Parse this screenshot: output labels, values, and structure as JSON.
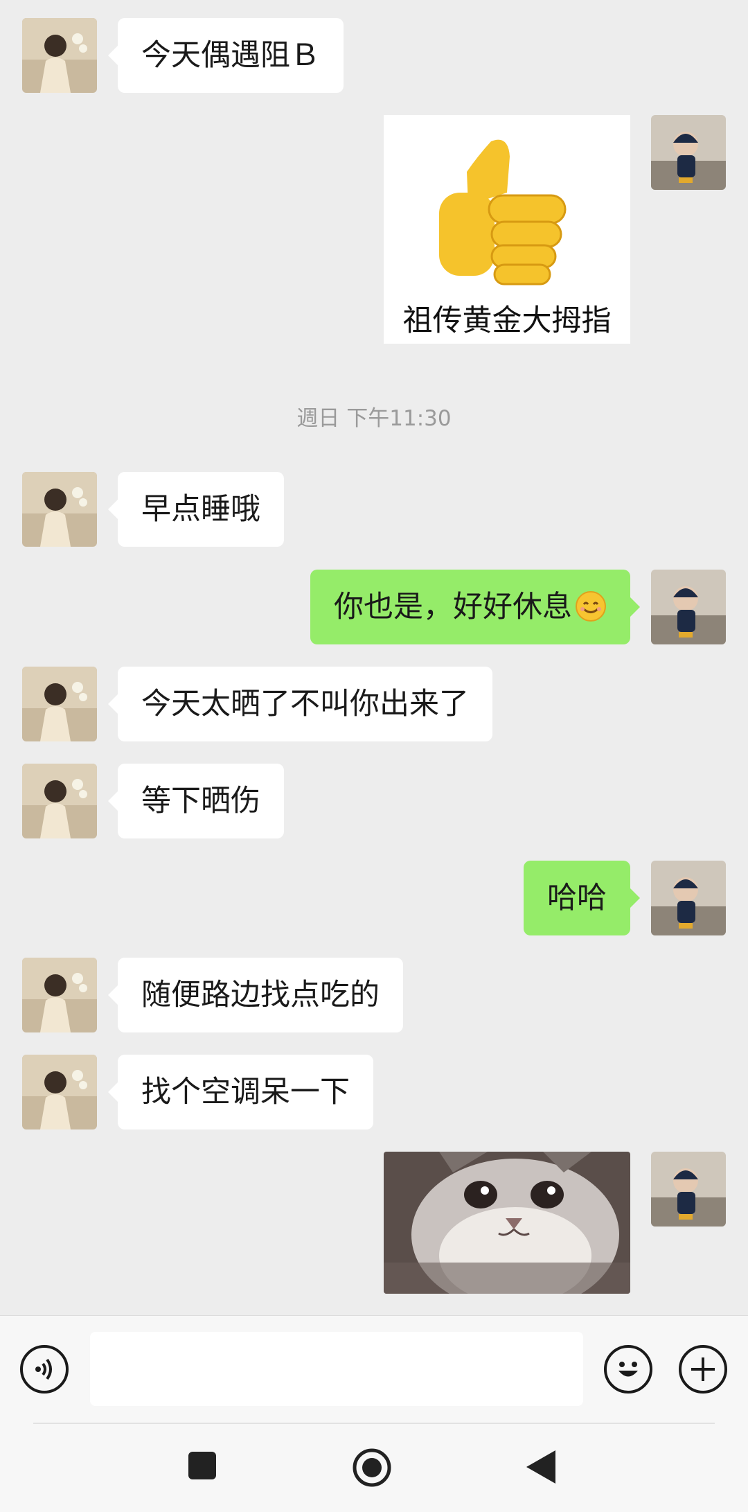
{
  "messages": [
    {
      "side": "in",
      "text": "今天偶遇阻Ｂ"
    },
    {
      "side": "out",
      "type": "sticker",
      "caption": "祖传黄金大拇指",
      "icon": "thumbs-up-emoji"
    },
    {
      "side": "in",
      "text": "早点睡哦"
    },
    {
      "side": "out",
      "text": "你也是，好好休息",
      "emoji": "smiling-face-emoji"
    },
    {
      "side": "in",
      "text": "今天太晒了不叫你出来了"
    },
    {
      "side": "in",
      "text": "等下晒伤"
    },
    {
      "side": "out",
      "text": "哈哈"
    },
    {
      "side": "in",
      "text": "随便路边找点吃的"
    },
    {
      "side": "in",
      "text": "找个空调呆一下"
    },
    {
      "side": "out",
      "type": "image",
      "image": "cat-photo"
    }
  ],
  "timestamp": "週日 下午11:30",
  "input": {
    "value": "",
    "placeholder": ""
  },
  "toolbar": {
    "voice_icon": "voice-icon",
    "emoji_icon": "emoji-icon",
    "plus_icon": "plus-icon"
  },
  "navbar": {
    "recent_icon": "square-recent-apps-icon",
    "home_icon": "circle-home-icon",
    "back_icon": "triangle-back-icon"
  },
  "colors": {
    "background": "#ededed",
    "outgoing_bubble": "#95ec69",
    "incoming_bubble": "#ffffff"
  }
}
